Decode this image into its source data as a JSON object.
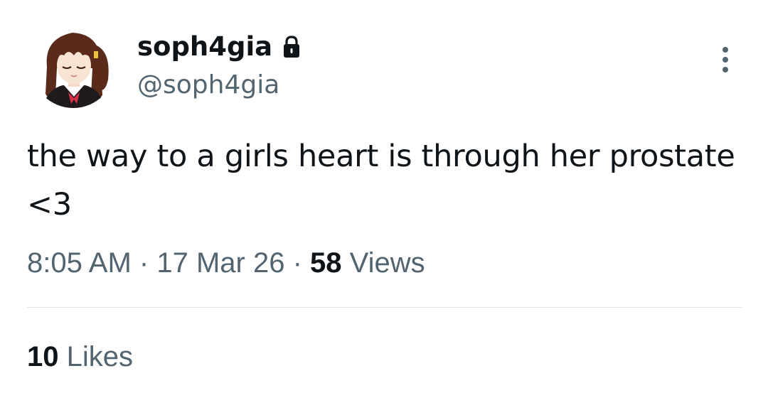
{
  "tweet": {
    "author": {
      "display_name": "soph4gia",
      "handle": "@soph4gia",
      "protected_icon": "lock-icon",
      "avatar": "anime-girl-avatar"
    },
    "text": "the way to a girls heart is through her prostate <3",
    "time": "8:05 AM",
    "separator": "·",
    "date": "17 Mar 26",
    "views_count": "58",
    "views_label": "Views",
    "likes_count": "10",
    "likes_label": "Likes",
    "more_icon": "more-vertical-icon"
  }
}
